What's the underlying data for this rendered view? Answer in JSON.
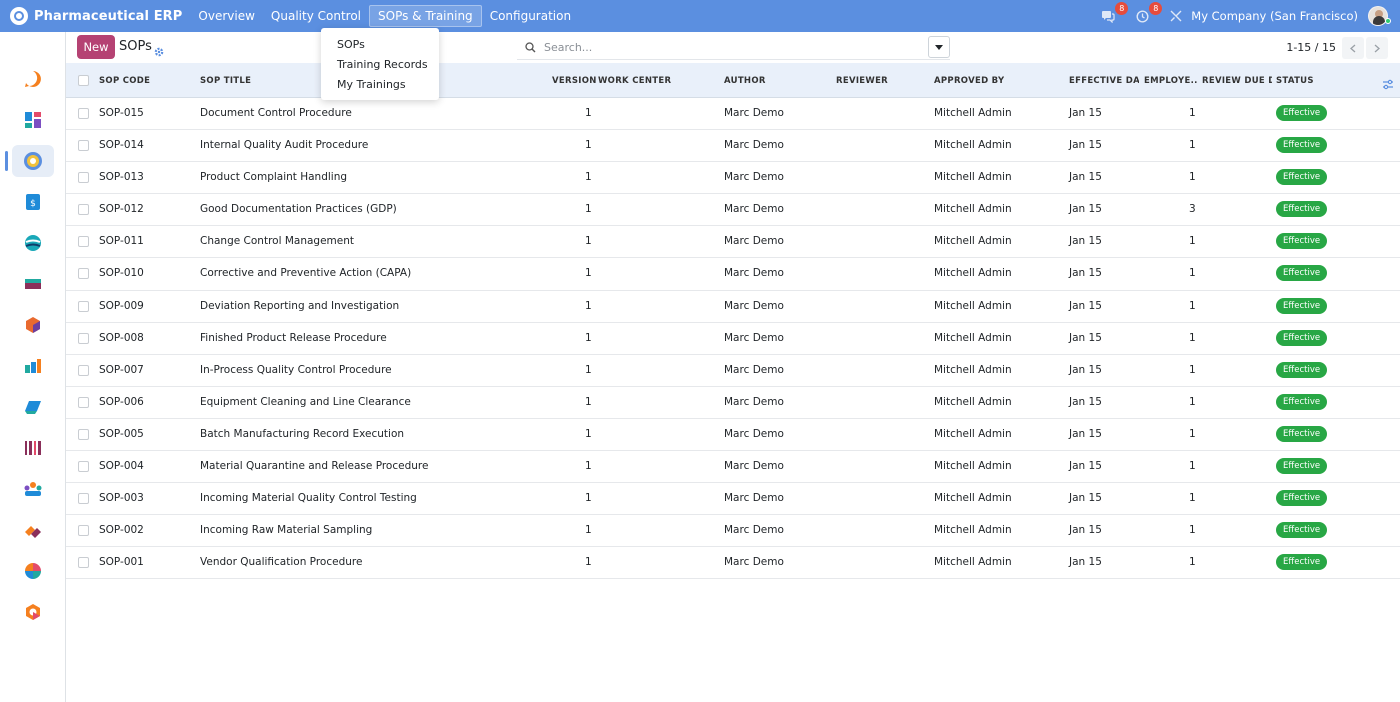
{
  "app": {
    "brand": "Pharmaceutical ERP"
  },
  "menu": [
    {
      "label": "Overview",
      "active": false
    },
    {
      "label": "Quality Control",
      "active": false
    },
    {
      "label": "SOPs & Training",
      "active": true
    },
    {
      "label": "Configuration",
      "active": false
    }
  ],
  "topright": {
    "messages_badge": "8",
    "activity_badge": "8",
    "company": "My Company (San Francisco)"
  },
  "dropdown": {
    "items": [
      "SOPs",
      "Training Records",
      "My Trainings"
    ]
  },
  "control": {
    "new_label": "New",
    "title": "SOPs",
    "search_placeholder": "Search...",
    "pager": "1-15 / 15"
  },
  "table": {
    "columns": [
      "SOP CODE",
      "SOP TITLE",
      "VERSION",
      "WORK CENTER",
      "AUTHOR",
      "REVIEWER",
      "APPROVED BY",
      "EFFECTIVE DA...",
      "EMPLOYE...",
      "REVIEW DUE D...",
      "STATUS"
    ],
    "rows": [
      {
        "code": "SOP-015",
        "title": "Document Control Procedure",
        "version": "1",
        "author": "Marc Demo",
        "approved": "Mitchell Admin",
        "effective": "Jan 15",
        "employees": "1",
        "status": "Effective"
      },
      {
        "code": "SOP-014",
        "title": "Internal Quality Audit Procedure",
        "version": "1",
        "author": "Marc Demo",
        "approved": "Mitchell Admin",
        "effective": "Jan 15",
        "employees": "1",
        "status": "Effective"
      },
      {
        "code": "SOP-013",
        "title": "Product Complaint Handling",
        "version": "1",
        "author": "Marc Demo",
        "approved": "Mitchell Admin",
        "effective": "Jan 15",
        "employees": "1",
        "status": "Effective"
      },
      {
        "code": "SOP-012",
        "title": "Good Documentation Practices (GDP)",
        "version": "1",
        "author": "Marc Demo",
        "approved": "Mitchell Admin",
        "effective": "Jan 15",
        "employees": "3",
        "status": "Effective"
      },
      {
        "code": "SOP-011",
        "title": "Change Control Management",
        "version": "1",
        "author": "Marc Demo",
        "approved": "Mitchell Admin",
        "effective": "Jan 15",
        "employees": "1",
        "status": "Effective"
      },
      {
        "code": "SOP-010",
        "title": "Corrective and Preventive Action (CAPA)",
        "version": "1",
        "author": "Marc Demo",
        "approved": "Mitchell Admin",
        "effective": "Jan 15",
        "employees": "1",
        "status": "Effective"
      },
      {
        "code": "SOP-009",
        "title": "Deviation Reporting and Investigation",
        "version": "1",
        "author": "Marc Demo",
        "approved": "Mitchell Admin",
        "effective": "Jan 15",
        "employees": "1",
        "status": "Effective"
      },
      {
        "code": "SOP-008",
        "title": "Finished Product Release Procedure",
        "version": "1",
        "author": "Marc Demo",
        "approved": "Mitchell Admin",
        "effective": "Jan 15",
        "employees": "1",
        "status": "Effective"
      },
      {
        "code": "SOP-007",
        "title": "In-Process Quality Control Procedure",
        "version": "1",
        "author": "Marc Demo",
        "approved": "Mitchell Admin",
        "effective": "Jan 15",
        "employees": "1",
        "status": "Effective"
      },
      {
        "code": "SOP-006",
        "title": "Equipment Cleaning and Line Clearance",
        "version": "1",
        "author": "Marc Demo",
        "approved": "Mitchell Admin",
        "effective": "Jan 15",
        "employees": "1",
        "status": "Effective"
      },
      {
        "code": "SOP-005",
        "title": "Batch Manufacturing Record Execution",
        "version": "1",
        "author": "Marc Demo",
        "approved": "Mitchell Admin",
        "effective": "Jan 15",
        "employees": "1",
        "status": "Effective"
      },
      {
        "code": "SOP-004",
        "title": "Material Quarantine and Release Procedure",
        "version": "1",
        "author": "Marc Demo",
        "approved": "Mitchell Admin",
        "effective": "Jan 15",
        "employees": "1",
        "status": "Effective"
      },
      {
        "code": "SOP-003",
        "title": "Incoming Material Quality Control Testing",
        "version": "1",
        "author": "Marc Demo",
        "approved": "Mitchell Admin",
        "effective": "Jan 15",
        "employees": "1",
        "status": "Effective"
      },
      {
        "code": "SOP-002",
        "title": "Incoming Raw Material Sampling",
        "version": "1",
        "author": "Marc Demo",
        "approved": "Mitchell Admin",
        "effective": "Jan 15",
        "employees": "1",
        "status": "Effective"
      },
      {
        "code": "SOP-001",
        "title": "Vendor Qualification Procedure",
        "version": "1",
        "author": "Marc Demo",
        "approved": "Mitchell Admin",
        "effective": "Jan 15",
        "employees": "1",
        "status": "Effective"
      }
    ]
  },
  "colors": {
    "topbar": "#5b8fe0",
    "new_button": "#b54273",
    "status_effective": "#28a745",
    "header_bg": "#e9f0fa"
  },
  "sidebar_icons": [
    "discuss-icon",
    "dashboard-icon",
    "quality-icon",
    "invoicing-icon",
    "website-icon",
    "inventory-icon",
    "product-icon",
    "manufacturing-icon",
    "purchase-icon",
    "barcode-icon",
    "employees-icon",
    "maintenance-icon",
    "planning-icon",
    "apps-icon"
  ]
}
